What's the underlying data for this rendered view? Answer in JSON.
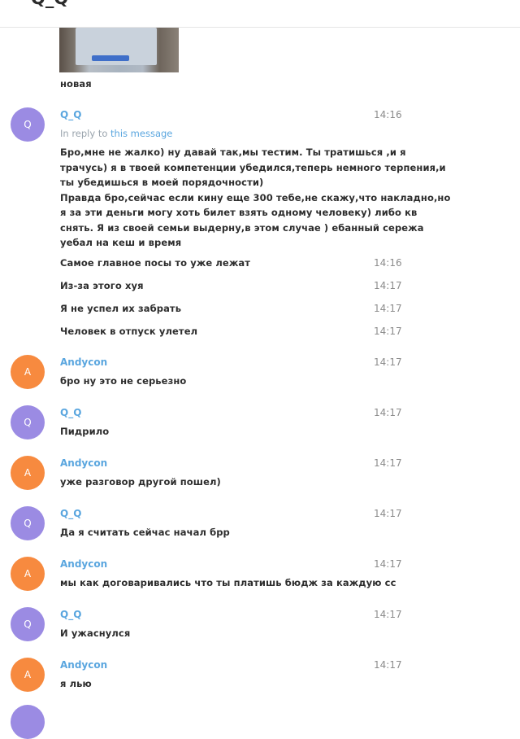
{
  "header": {
    "title": "Q_Q"
  },
  "photo_caption": "новая",
  "reply": {
    "prefix": "In reply to",
    "link": "this message"
  },
  "first": {
    "name": "Q_Q",
    "time": "14:16",
    "avatar_letter": "Q",
    "lines": [
      "Бро,мне не жалко) ну давай так,мы тестим. Ты тратишься ,и я",
      "трачусь) я в твоей компетенции убедился,теперь немного терпения,и",
      "ты убедишься в моей порядочности)",
      "Правда бро,сейчас если кину еще 300 тебе,не скажу,что накладно,но",
      "я за эти деньги могу хоть билет взять одному человеку) либо кв",
      "снять. Я из своей семьи выдерну,в этом случае ) ебанный сережа",
      "уебал на кеш и время"
    ]
  },
  "followups": [
    {
      "text": "Самое главное посы то уже лежат",
      "time": "14:16"
    },
    {
      "text": "Из-за этого хуя",
      "time": "14:17"
    },
    {
      "text": "Я не успел их забрать",
      "time": "14:17"
    },
    {
      "text": "Человек в отпуск улетел",
      "time": "14:17"
    }
  ],
  "messages": [
    {
      "sender": "Andycon",
      "avatar_letter": "A",
      "time": "14:17",
      "text": "бро ну это не серьезно"
    },
    {
      "sender": "Q_Q",
      "avatar_letter": "Q",
      "time": "14:17",
      "text": "Пидрило"
    },
    {
      "sender": "Andycon",
      "avatar_letter": "A",
      "time": "14:17",
      "text": "уже разговор другой пошел)"
    },
    {
      "sender": "Q_Q",
      "avatar_letter": "Q",
      "time": "14:17",
      "text": "Да я считать сейчас начал брр"
    },
    {
      "sender": "Andycon",
      "avatar_letter": "A",
      "time": "14:17",
      "text": "мы как договаривались что ты платишь бюдж за каждую сс"
    },
    {
      "sender": "Q_Q",
      "avatar_letter": "Q",
      "time": "14:17",
      "text": "И ужаснулся"
    },
    {
      "sender": "Andycon",
      "avatar_letter": "A",
      "time": "14:17",
      "text": "я лью"
    }
  ],
  "colors": {
    "accent": "#5aa6df",
    "avatar_q": "#9b8be3",
    "avatar_a": "#f78a3f",
    "time": "#8c8c8c"
  }
}
